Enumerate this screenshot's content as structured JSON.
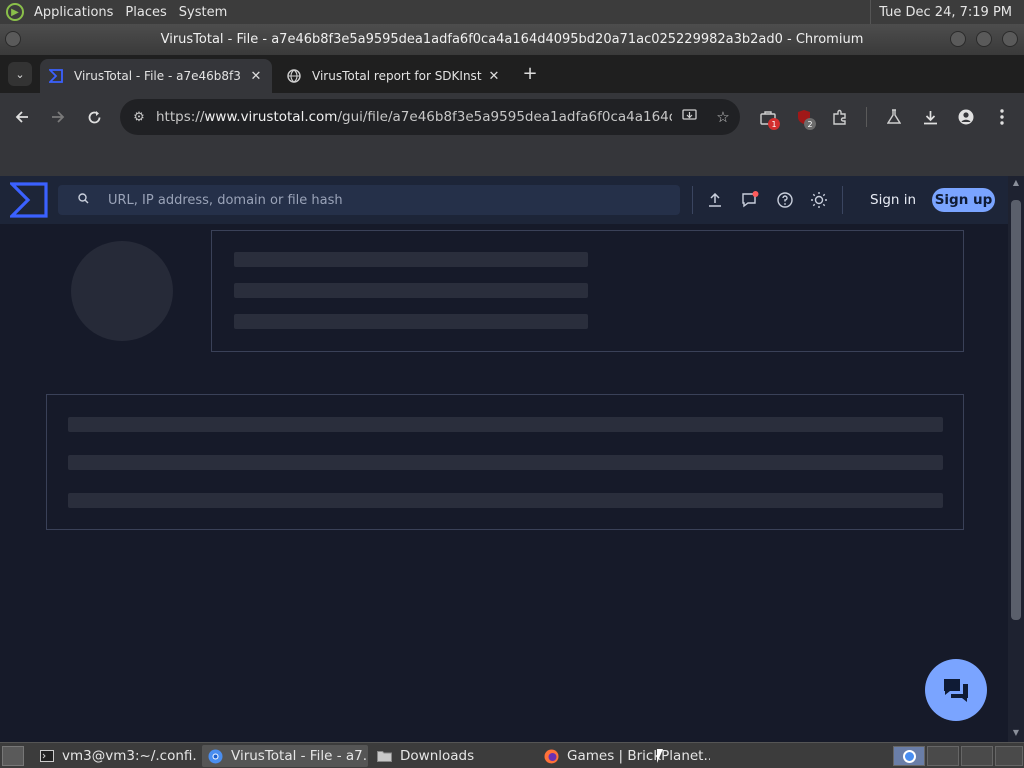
{
  "top_panel": {
    "menus": [
      "Applications",
      "Places",
      "System"
    ],
    "clock": "Tue Dec 24,  7:19 PM"
  },
  "window": {
    "title": "VirusTotal - File - a7e46b8f3e5a9595dea1adfa6f0ca4a164d4095bd20a71ac025229982a3b2ad0 - Chromium"
  },
  "tabs": [
    {
      "title": "VirusTotal - File - a7e46b8f3",
      "favicon": "virustotal-icon",
      "active": true,
      "close": "✕"
    },
    {
      "title": "VirusTotal report for SDKInst",
      "favicon": "globe-icon",
      "active": false,
      "close": "✕"
    }
  ],
  "toolbar": {
    "url_scheme": "https://",
    "url_host": "www.virustotal.com",
    "url_path": "/gui/file/a7e46b8f3e5a9595dea1adfa6f0ca4a164d4...",
    "extension_badges": [
      "1",
      "2"
    ]
  },
  "vt": {
    "search_placeholder": "URL, IP address, domain or file hash",
    "signin_label": "Sign in",
    "signup_label": "Sign up"
  },
  "taskbar": {
    "items": [
      {
        "label": "vm3@vm3:~/.confi...",
        "icon": "terminal-icon",
        "active": false
      },
      {
        "label": "VirusTotal - File - a7...",
        "icon": "chromium-icon",
        "active": true
      },
      {
        "label": "Downloads",
        "icon": "folder-icon",
        "active": false
      },
      {
        "label": "Games | BrickPlanet...",
        "icon": "firefox-icon",
        "active": false
      }
    ]
  },
  "colors": {
    "page_bg": "#161a29",
    "header_bg": "#1d2538",
    "accent": "#7aa4ff",
    "skeleton": "#2a2e3c"
  }
}
